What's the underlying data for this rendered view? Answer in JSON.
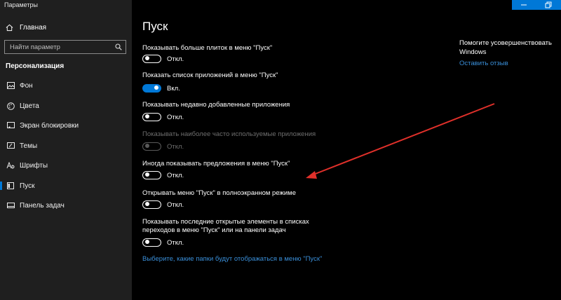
{
  "window": {
    "title": "Параметры",
    "accent_color": "#0078d7"
  },
  "sidebar": {
    "home_label": "Главная",
    "search_placeholder": "Найти параметр",
    "section_title": "Персонализация",
    "items": [
      {
        "label": "Фон",
        "icon": "image-icon"
      },
      {
        "label": "Цвета",
        "icon": "palette-icon"
      },
      {
        "label": "Экран блокировки",
        "icon": "lock-screen-icon"
      },
      {
        "label": "Темы",
        "icon": "brush-icon"
      },
      {
        "label": "Шрифты",
        "icon": "font-icon"
      },
      {
        "label": "Пуск",
        "icon": "start-icon",
        "active": true
      },
      {
        "label": "Панель задач",
        "icon": "taskbar-icon"
      }
    ]
  },
  "main": {
    "title": "Пуск",
    "settings": [
      {
        "label": "Показывать больше плиток в меню \"Пуск\"",
        "state": "Откл.",
        "on": false,
        "disabled": false
      },
      {
        "label": "Показать список приложений в меню \"Пуск\"",
        "state": "Вкл.",
        "on": true,
        "disabled": false
      },
      {
        "label": "Показывать недавно добавленные приложения",
        "state": "Откл.",
        "on": false,
        "disabled": false
      },
      {
        "label": "Показывать наиболее часто используемые приложения",
        "state": "Откл.",
        "on": false,
        "disabled": true
      },
      {
        "label": "Иногда показывать предложения в меню \"Пуск\"",
        "state": "Откл.",
        "on": false,
        "disabled": false
      },
      {
        "label": "Открывать меню \"Пуск\" в полноэкранном режиме",
        "state": "Откл.",
        "on": false,
        "disabled": false
      },
      {
        "label_line1": "Показывать последние открытые элементы в списках",
        "label_line2": "переходов в меню \"Пуск\" или на панели задач",
        "state": "Откл.",
        "on": false,
        "disabled": false
      }
    ],
    "folders_link": "Выберите, какие папки будут отображаться в меню \"Пуск\""
  },
  "side_panel": {
    "title": "Помогите усовершенствовать Windows",
    "feedback_link": "Оставить отзыв"
  },
  "annotation": {
    "type": "red-arrow",
    "color": "#e0302a"
  }
}
